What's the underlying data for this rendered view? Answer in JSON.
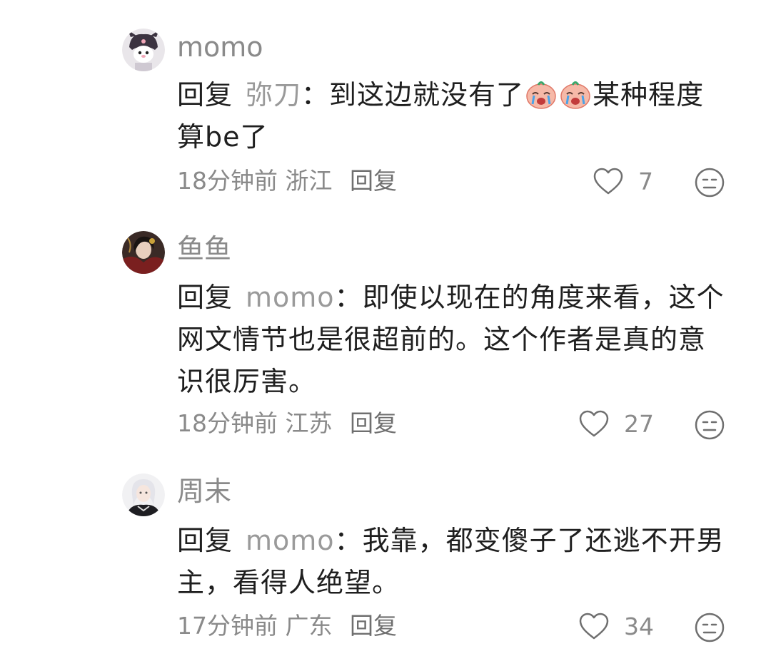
{
  "comments": [
    {
      "username": "momo",
      "reply_label": "回复",
      "reply_to": "弥刀",
      "colon": "：",
      "text_before": "到这边就没有了",
      "emoji_names": [
        "crying-face-emoji",
        "crying-face-emoji"
      ],
      "text_after": "某种程度算be了",
      "time": "18分钟前",
      "location": "浙江",
      "reply_action": "回复",
      "like_count": "7"
    },
    {
      "username": "鱼鱼",
      "reply_label": "回复",
      "reply_to": "momo",
      "colon": "：",
      "text": "即使以现在的角度来看，这个网文情节也是很超前的。这个作者是真的意识很厉害。",
      "time": "18分钟前",
      "location": "江苏",
      "reply_action": "回复",
      "like_count": "27"
    },
    {
      "username": "周末",
      "reply_label": "回复",
      "reply_to": "momo",
      "colon": "：",
      "text": "我靠，都变傻子了还逃不开男主，看得人绝望。",
      "time": "17分钟前",
      "location": "广东",
      "reply_action": "回复",
      "like_count": "34"
    }
  ],
  "icons": {
    "like": "heart-outline-icon",
    "dislike": "meh-face-icon"
  },
  "colors": {
    "secondary_text": "#8a8a8a",
    "primary_text": "#1f1f1f",
    "emoji_accent": "#f08a7c"
  }
}
